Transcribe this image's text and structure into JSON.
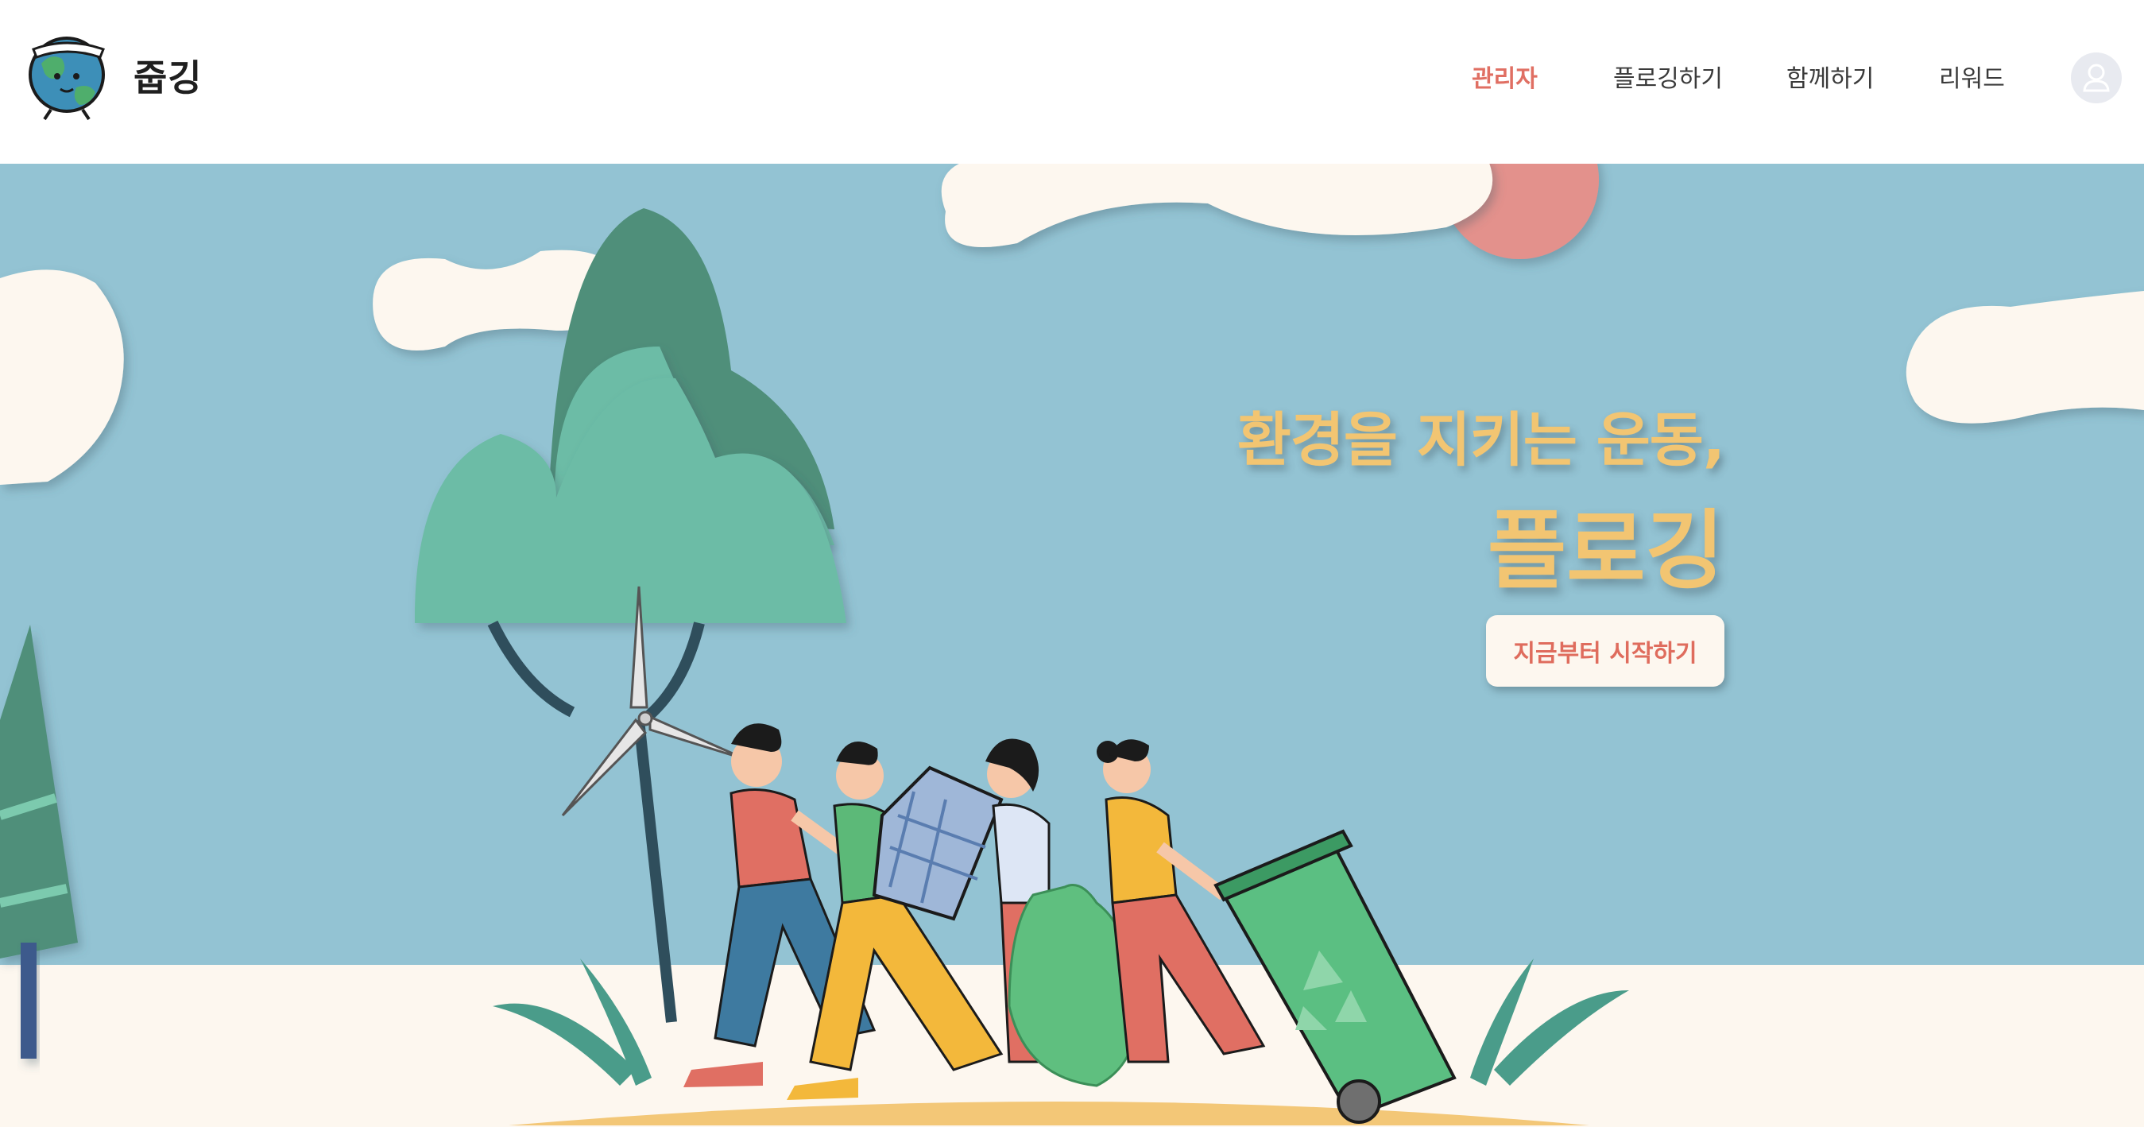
{
  "header": {
    "brand": "줍깅",
    "nav": [
      {
        "label": "관리자",
        "active": true
      },
      {
        "label": "플로깅하기",
        "active": false
      },
      {
        "label": "함께하기",
        "active": false
      },
      {
        "label": "리워드",
        "active": false
      }
    ],
    "avatar_icon": "user-icon"
  },
  "hero": {
    "subtitle": "환경을 지키는 운동,",
    "title": "플로깅",
    "cta_label": "지금부터 시작하기"
  },
  "colors": {
    "sky": "#93c3d3",
    "ground": "#fdf7ef",
    "accent": "#e06f63",
    "headline": "#f2c572"
  }
}
